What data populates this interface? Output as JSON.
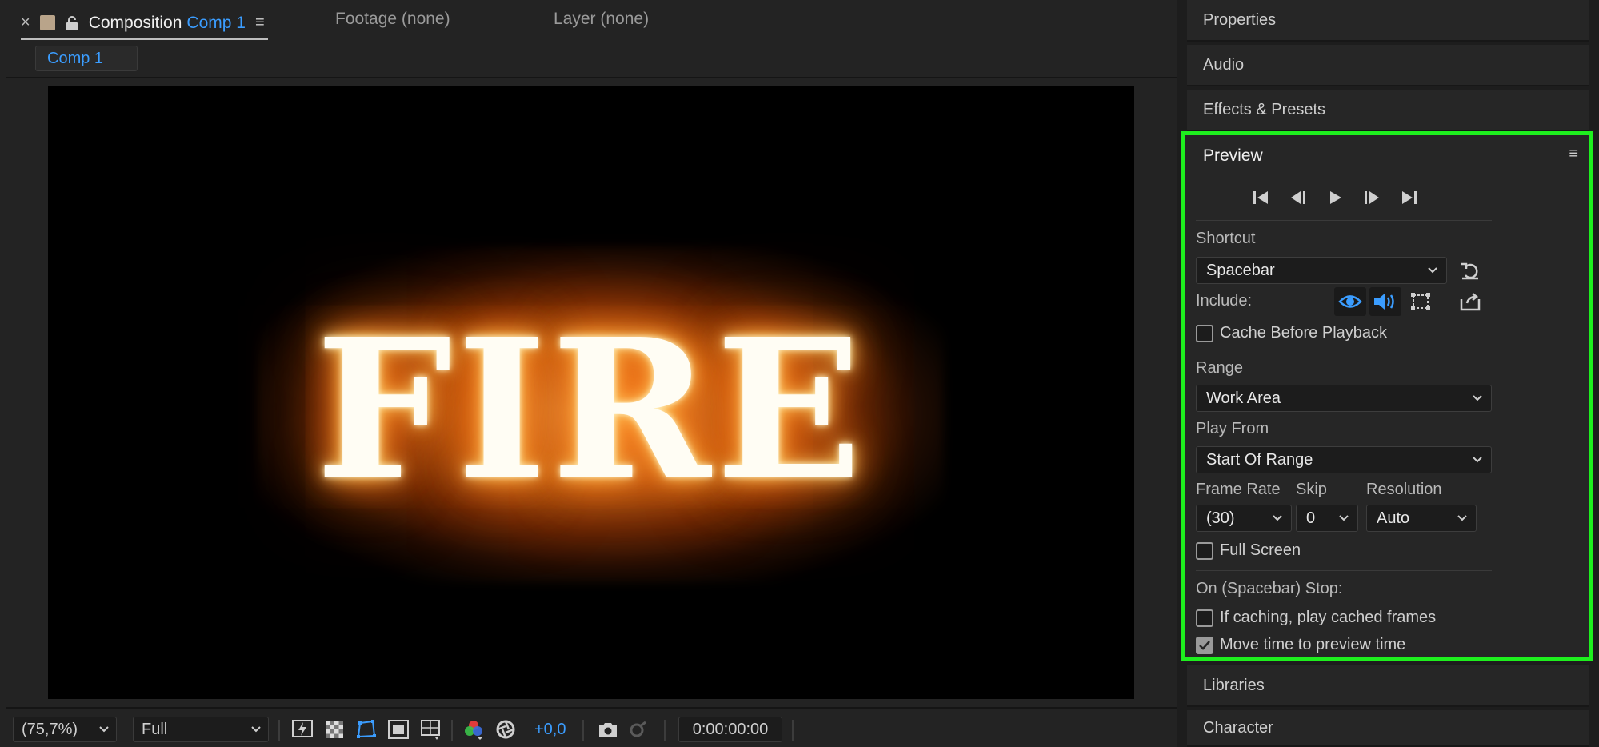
{
  "composition_tab": {
    "close": "×",
    "label": "Composition",
    "comp_name": "Comp 1",
    "menu": "≡"
  },
  "footage_tab": "Footage (none)",
  "layer_tab": "Layer (none)",
  "breadcrumb": "Comp 1",
  "viewer": {
    "text": "FIRE"
  },
  "viewer_toolbar": {
    "zoom": "(75,7%)",
    "resolution": "Full",
    "exposure": "+0,0",
    "timecode": "0:00:00:00"
  },
  "panels": {
    "properties": "Properties",
    "audio": "Audio",
    "effects": "Effects & Presets",
    "libraries": "Libraries",
    "character": "Character"
  },
  "preview": {
    "title": "Preview",
    "menu": "≡",
    "shortcut_label": "Shortcut",
    "shortcut_value": "Spacebar",
    "include_label": "Include:",
    "cache_before_playback": "Cache Before Playback",
    "range_label": "Range",
    "range_value": "Work Area",
    "play_from_label": "Play From",
    "play_from_value": "Start Of Range",
    "frame_rate_label": "Frame Rate",
    "frame_rate_value": "(30)",
    "skip_label": "Skip",
    "skip_value": "0",
    "resolution_label": "Resolution",
    "resolution_value": "Auto",
    "full_screen": "Full Screen",
    "on_stop_label": "On (Spacebar) Stop:",
    "if_caching": "If caching, play cached frames",
    "move_time": "Move time to preview time"
  },
  "colors": {
    "accent_blue": "#3b9dff",
    "highlight_green": "#1eef1e",
    "panel_bg": "#262626"
  }
}
